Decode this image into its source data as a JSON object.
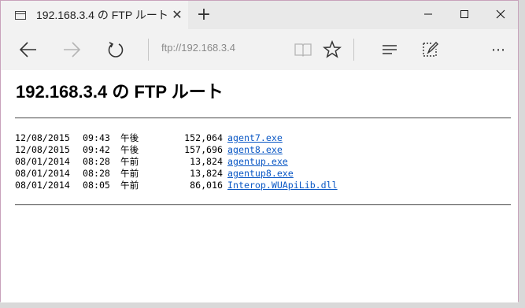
{
  "tab": {
    "title": "192.168.3.4 の FTP ルート",
    "close": "✕",
    "new": "+"
  },
  "window_controls": {
    "minimize": "—",
    "maximize": "☐",
    "close": "✕"
  },
  "address": {
    "url": "ftp://192.168.3.4"
  },
  "toolbar": {
    "more": "⋯"
  },
  "page": {
    "heading": "192.168.3.4 の FTP ルート"
  },
  "files": [
    {
      "date": "12/08/2015",
      "time": "09:43",
      "period": "午後",
      "size": "152,064",
      "name": "agent7.exe"
    },
    {
      "date": "12/08/2015",
      "time": "09:42",
      "period": "午後",
      "size": "157,696",
      "name": "agent8.exe"
    },
    {
      "date": "08/01/2014",
      "time": "08:28",
      "period": "午前",
      "size": "13,824",
      "name": "agentup.exe"
    },
    {
      "date": "08/01/2014",
      "time": "08:28",
      "period": "午前",
      "size": "13,824",
      "name": "agentup8.exe"
    },
    {
      "date": "08/01/2014",
      "time": "08:05",
      "period": "午前",
      "size": "86,016",
      "name": "Interop.WUApiLib.dll"
    }
  ],
  "colors": {
    "link": "#0b58c5",
    "chrome": "#f2f2f2",
    "frame": "#c8a2bb"
  }
}
